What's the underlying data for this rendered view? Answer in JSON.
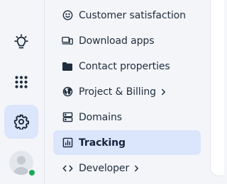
{
  "rail": {
    "items": [
      {
        "icon": "lightbulb-icon",
        "active": false
      },
      {
        "icon": "apps-grid-icon",
        "active": false
      },
      {
        "icon": "gear-icon",
        "active": true
      }
    ],
    "user": {
      "icon": "user-avatar-icon",
      "status": "online"
    }
  },
  "nav": {
    "items": [
      {
        "label": "Customer satisfaction",
        "icon": "smiley-icon",
        "has_submenu": false,
        "active": false
      },
      {
        "label": "Download apps",
        "icon": "devices-icon",
        "has_submenu": false,
        "active": false
      },
      {
        "label": "Contact properties",
        "icon": "folder-icon",
        "has_submenu": false,
        "active": false
      },
      {
        "label": "Project & Billing",
        "icon": "globe-icon",
        "has_submenu": true,
        "active": false
      },
      {
        "label": "Domains",
        "icon": "server-icon",
        "has_submenu": false,
        "active": false
      },
      {
        "label": "Tracking",
        "icon": "analytics-icon",
        "has_submenu": false,
        "active": true
      },
      {
        "label": "Developer",
        "icon": "code-icon",
        "has_submenu": true,
        "active": false
      }
    ]
  },
  "colors": {
    "background": "#f3f5f9",
    "active_bg": "#dbe5fb",
    "text": "#1f2d3d",
    "online": "#18a957"
  }
}
